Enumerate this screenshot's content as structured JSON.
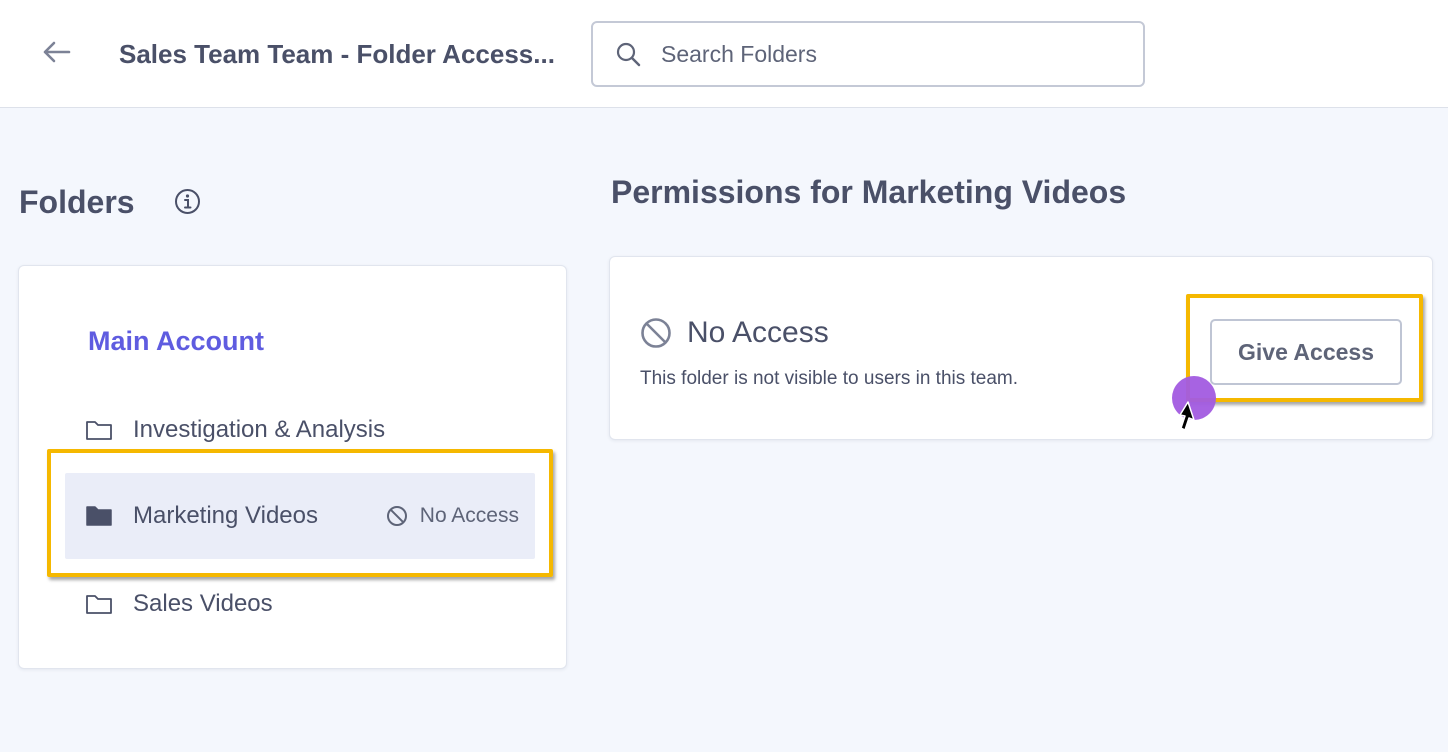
{
  "header": {
    "title": "Sales Team Team - Folder Access...",
    "back_icon": "arrow-left-icon",
    "search": {
      "placeholder": "Search Folders",
      "value": ""
    }
  },
  "sidebar": {
    "heading": "Folders",
    "account_name": "Main Account",
    "folders": [
      {
        "label": "Investigation & Analysis",
        "selected": false,
        "status": ""
      },
      {
        "label": "Marketing Videos",
        "selected": true,
        "status": "No Access"
      },
      {
        "label": "Sales Videos",
        "selected": false,
        "status": ""
      }
    ]
  },
  "permissions": {
    "heading": "Permissions for Marketing Videos",
    "status_label": "No Access",
    "description": "This folder is not visible to users in this team.",
    "button_label": "Give Access"
  },
  "colors": {
    "accent": "#5f5ce0",
    "highlight": "#f5b800",
    "click_indicator": "#a25be0",
    "text": "#4a5068"
  }
}
